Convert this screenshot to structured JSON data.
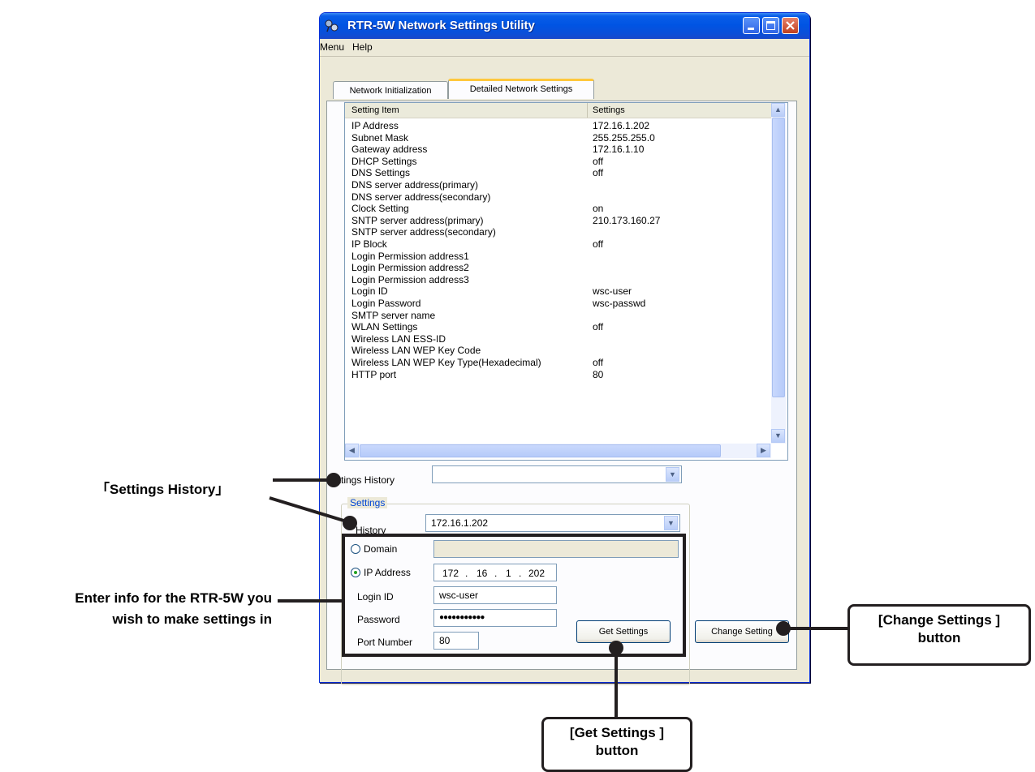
{
  "window": {
    "title": "RTR-5W Network Settings Utility"
  },
  "menu": [
    "Menu",
    "Help"
  ],
  "tabs": [
    "Network Initialization",
    "Detailed Network Settings"
  ],
  "list": {
    "headers": [
      "Setting Item",
      "Settings"
    ],
    "rows": [
      [
        "IP Address",
        "172.16.1.202"
      ],
      [
        "Subnet Mask",
        "255.255.255.0"
      ],
      [
        "Gateway address",
        "172.16.1.10"
      ],
      [
        "DHCP Settings",
        "off"
      ],
      [
        "DNS Settings",
        "off"
      ],
      [
        "DNS server address(primary)",
        ""
      ],
      [
        "DNS server address(secondary)",
        ""
      ],
      [
        "Clock Setting",
        "on"
      ],
      [
        "SNTP server address(primary)",
        "210.173.160.27"
      ],
      [
        "SNTP server address(secondary)",
        ""
      ],
      [
        "IP Block",
        "off"
      ],
      [
        "Login Permission address1",
        ""
      ],
      [
        "Login Permission address2",
        ""
      ],
      [
        "Login Permission address3",
        ""
      ],
      [
        "Login ID",
        "wsc-user"
      ],
      [
        "Login Password",
        "wsc-passwd"
      ],
      [
        "SMTP server name",
        ""
      ],
      [
        "WLAN Settings",
        "off"
      ],
      [
        "Wireless LAN ESS-ID",
        ""
      ],
      [
        "Wireless LAN WEP Key Code",
        ""
      ],
      [
        "Wireless LAN WEP Key Type(Hexadecimal)",
        "off"
      ],
      [
        "HTTP port",
        "80"
      ]
    ]
  },
  "settings_history": {
    "label": "Settings History",
    "value": ""
  },
  "settings_group": {
    "title": "Settings",
    "history_label": "History",
    "history_value": "172.16.1.202",
    "domain_label": "Domain",
    "domain_value": "",
    "ip_label": "IP Address",
    "ip_octets": [
      "172",
      "16",
      "1",
      "202"
    ],
    "login_id_label": "Login ID",
    "login_id_value": "wsc-user",
    "password_label": "Password",
    "password_value": "●●●●●●●●●●●",
    "port_label": "Port Number",
    "port_value": "80"
  },
  "buttons": {
    "get_settings": "Get Settings",
    "change_settings": "Change Setting"
  },
  "callouts": {
    "settings_history": "「Settings History」",
    "enter_info_line1": "Enter info for the RTR-5W you",
    "enter_info_line2": "wish to make settings in",
    "change_settings_line1": "[Change Settings ]",
    "change_settings_line2": "button",
    "get_settings_line1": "[Get Settings ]",
    "get_settings_line2": "button"
  }
}
